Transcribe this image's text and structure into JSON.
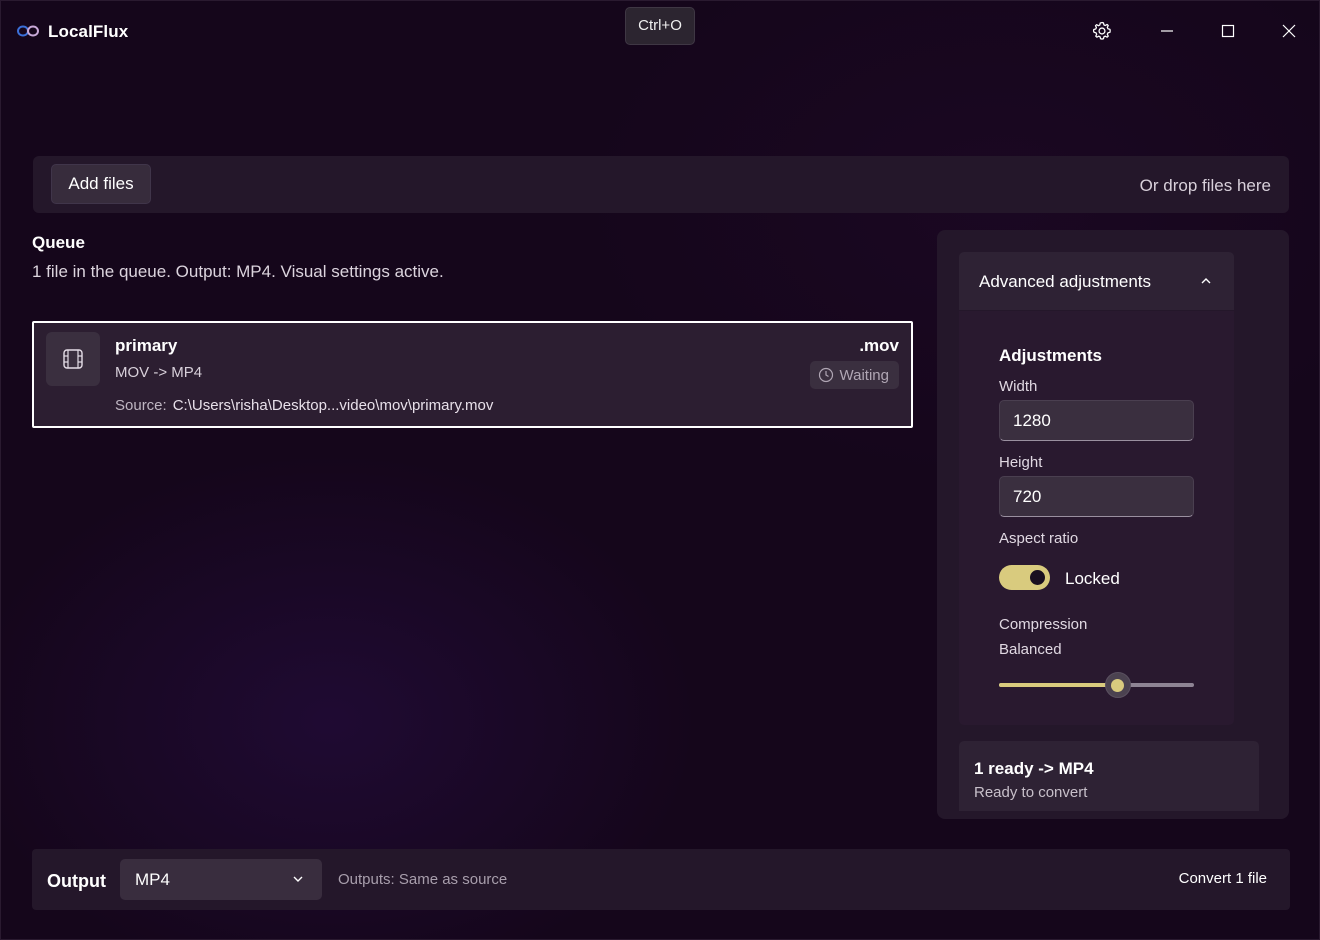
{
  "app": {
    "title": "LocalFlux",
    "tooltip": "Ctrl+O",
    "icons": {
      "logo": "infinity-logo-icon",
      "settings": "gear-icon",
      "minimize": "minimize-icon",
      "maximize": "maximize-icon",
      "close": "close-icon"
    }
  },
  "dropzone": {
    "add_label": "Add files",
    "hint": "Or drop files here"
  },
  "queue": {
    "title": "Queue",
    "summary": "1 file in the queue. Output: MP4. Visual settings active.",
    "items": [
      {
        "name": "primary",
        "conversion": "MOV -> MP4",
        "source_label": "Source:",
        "source_path": "C:\\Users\\risha\\Desktop...video\\mov\\primary.mov",
        "extension": ".mov",
        "status": "Waiting",
        "icon": "film-icon",
        "status_icon": "clock-icon"
      }
    ]
  },
  "advanced": {
    "title": "Advanced adjustments",
    "expanded": true,
    "section_title": "Adjustments",
    "width_label": "Width",
    "width_value": "1280",
    "height_label": "Height",
    "height_value": "720",
    "aspect_label": "Aspect ratio",
    "aspect_toggle_on": true,
    "aspect_state": "Locked",
    "compression_label": "Compression",
    "compression_value": "Balanced",
    "compression_level": 0.61,
    "accent_color": "#d9cb7e"
  },
  "summary": {
    "title": "1 ready -> MP4",
    "subtitle": "Ready to convert"
  },
  "output": {
    "label": "Output",
    "format": "MP4",
    "destination": "Outputs: Same as source",
    "convert_label": "Convert 1 file"
  }
}
